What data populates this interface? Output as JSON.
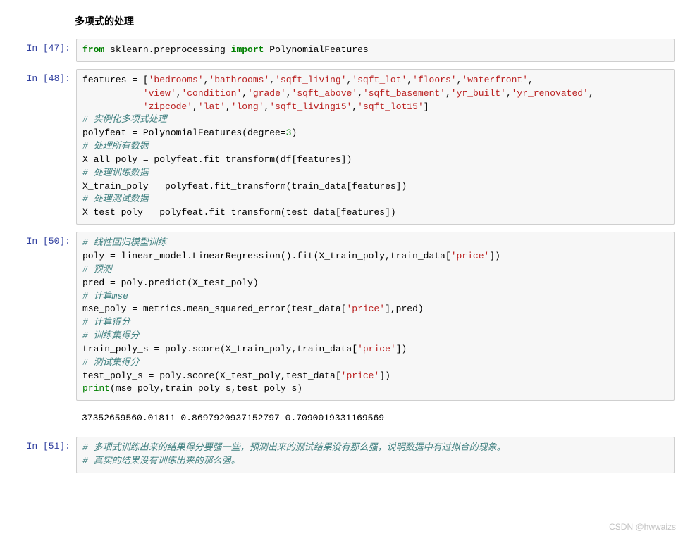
{
  "heading": "多项式的处理",
  "cells": [
    {
      "prompt": "In  [47]:",
      "html": "<span class='kw-green'>from</span> sklearn.preprocessing <span class='kw-green'>import</span> PolynomialFeatures"
    },
    {
      "prompt": "In  [48]:",
      "html": "features = [<span class='str'>'bedrooms'</span>,<span class='str'>'bathrooms'</span>,<span class='str'>'sqft_living'</span>,<span class='str'>'sqft_lot'</span>,<span class='str'>'floors'</span>,<span class='str'>'waterfront'</span>,\n           <span class='str'>'view'</span>,<span class='str'>'condition'</span>,<span class='str'>'grade'</span>,<span class='str'>'sqft_above'</span>,<span class='str'>'sqft_basement'</span>,<span class='str'>'yr_built'</span>,<span class='str'>'yr_renovated'</span>,\n           <span class='str'>'zipcode'</span>,<span class='str'>'lat'</span>,<span class='str'>'long'</span>,<span class='str'>'sqft_living15'</span>,<span class='str'>'sqft_lot15'</span>]\n<span class='comment'># 实例化多项式处理</span>\npolyfeat = PolynomialFeatures(degree=<span class='num'>3</span>)\n<span class='comment'># 处理所有数据</span>\nX_all_poly = polyfeat.fit_transform(df[features])\n<span class='comment'># 处理训练数据</span>\nX_train_poly = polyfeat.fit_transform(train_data[features])\n<span class='comment'># 处理测试数据</span>\nX_test_poly = polyfeat.fit_transform(test_data[features])"
    },
    {
      "prompt": "In  [50]:",
      "html": "<span class='comment'># 线性回归模型训练</span>\npoly = linear_model.LinearRegression().fit(X_train_poly,train_data[<span class='str'>'price'</span>])\n<span class='comment'># 预测</span>\npred = poly.predict(X_test_poly)\n<span class='comment'># 计算mse</span>\nmse_poly = metrics.mean_squared_error(test_data[<span class='str'>'price'</span>],pred)\n<span class='comment'># 计算得分</span>\n<span class='comment'># 训练集得分</span>\ntrain_poly_s = poly.score(X_train_poly,train_data[<span class='str'>'price'</span>])\n<span class='comment'># 测试集得分</span>\ntest_poly_s = poly.score(X_test_poly,test_data[<span class='str'>'price'</span>])\n<span class='builtin'>print</span>(mse_poly,train_poly_s,test_poly_s)"
    }
  ],
  "output50": "37352659560.01811 0.8697920937152797 0.7090019331169569",
  "cell51": {
    "prompt": "In  [51]:",
    "html": "<span class='comment'># 多项式训练出来的结果得分要强一些，预测出来的测试结果没有那么强，说明数据中有过拟合的现象。</span>\n<span class='comment'># 真实的结果没有训练出来的那么强。</span>"
  },
  "watermark": "CSDN @hwwaizs"
}
